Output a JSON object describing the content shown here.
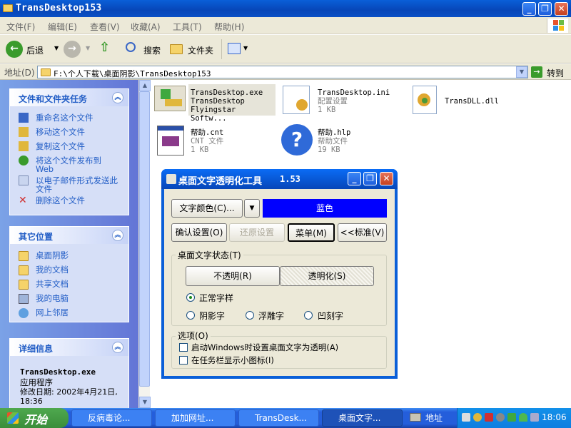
{
  "window": {
    "title": "TransDesktop153"
  },
  "menu": [
    "文件(F)",
    "编辑(E)",
    "查看(V)",
    "收藏(A)",
    "工具(T)",
    "帮助(H)"
  ],
  "toolbar": {
    "back": "后退",
    "search": "搜索",
    "folders": "文件夹"
  },
  "address": {
    "label": "地址(D)",
    "path": "F:\\个人下载\\桌面阴影\\TransDesktop153",
    "go": "转到"
  },
  "tasks_panel": {
    "title": "文件和文件夹任务",
    "items": [
      "重命名这个文件",
      "移动这个文件",
      "复制这个文件",
      "将这个文件发布到 Web",
      "以电子邮件形式发送此文件",
      "删除这个文件"
    ]
  },
  "places_panel": {
    "title": "其它位置",
    "items": [
      "桌面阴影",
      "我的文档",
      "共享文档",
      "我的电脑",
      "网上邻居"
    ]
  },
  "details_panel": {
    "title": "详细信息",
    "name": "TransDesktop.exe",
    "type": "应用程序",
    "modified": "修改日期: 2002年4月21日, 18:36"
  },
  "files": [
    {
      "name": "TransDesktop.exe",
      "line2": "TransDesktop",
      "line3": "Flyingstar Softw...",
      "icon": "application-icon"
    },
    {
      "name": "TransDesktop.ini",
      "line2": "配置设置",
      "line3": "1 KB",
      "icon": "ini-config-icon"
    },
    {
      "name": "TransDLL.dll",
      "line2": "",
      "line3": "",
      "icon": "dll-icon"
    },
    {
      "name": "帮助.cnt",
      "line2": "CNT 文件",
      "line3": "1 KB",
      "icon": "cnt-file-icon"
    },
    {
      "name": "帮助.hlp",
      "line2": "帮助文件",
      "line3": "19 KB",
      "icon": "help-file-icon"
    }
  ],
  "dialog": {
    "title": "桌面文字透明化工具",
    "version": "1.53",
    "color_button": "文字颜色(C)...",
    "color_value": "蓝色",
    "color_hex": "#0000ff",
    "buttons": [
      "确认设置(O)",
      "还原设置",
      "菜单(M)",
      "<<标准(V)"
    ],
    "state_group": "桌面文字状态(T)",
    "opaque": "不透明(R)",
    "transparent": "透明化(S)",
    "radios": [
      "正常字样",
      "阴影字",
      "浮雕字",
      "凹刻字"
    ],
    "options_group": "选项(O)",
    "checks": [
      "启动Windows时设置桌面文字为透明(A)",
      "在任务栏显示小图标(I)"
    ]
  },
  "taskbar": {
    "start": "开始",
    "tasks": [
      "反病毒论...",
      "加加网址...",
      "TransDesk...",
      "桌面文字..."
    ],
    "address_toolbar": "地址",
    "clock": "18:06"
  }
}
